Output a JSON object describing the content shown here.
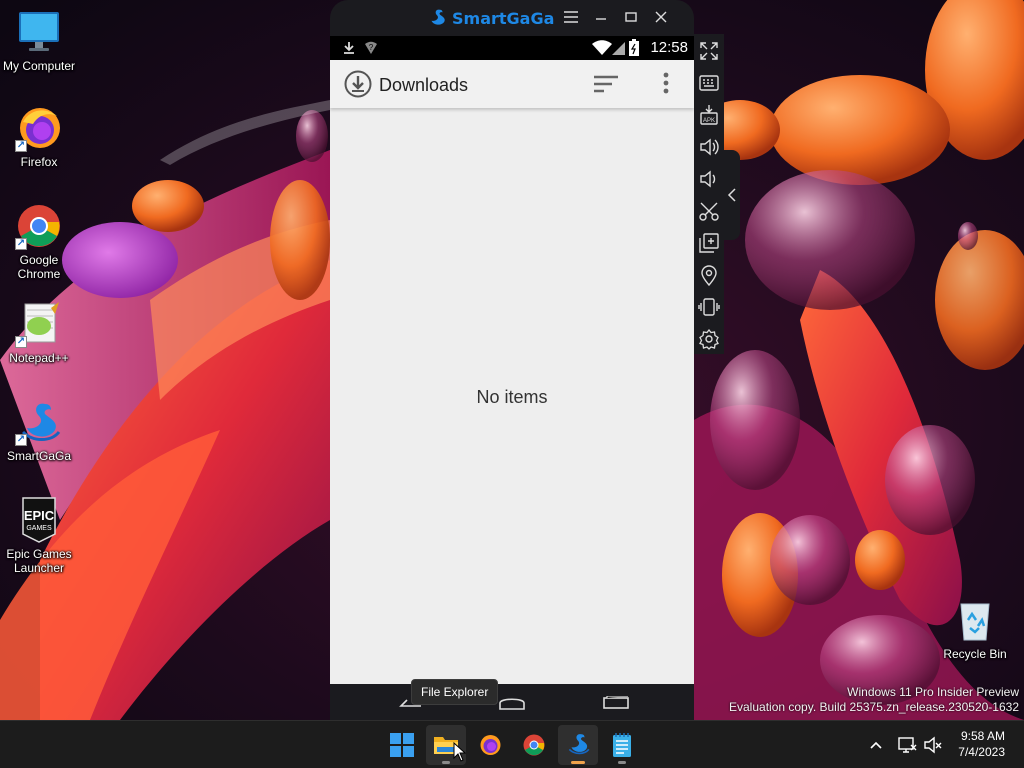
{
  "desktop": {
    "icons": [
      {
        "label": "My Computer"
      },
      {
        "label": "Firefox"
      },
      {
        "label": "Google Chrome"
      },
      {
        "label": "Notepad++"
      },
      {
        "label": "SmartGaGa"
      },
      {
        "label": "Epic Games Launcher"
      },
      {
        "label": "Recycle Bin"
      }
    ]
  },
  "emulator": {
    "window_title": "SmartGaGa",
    "status_time": "12:58",
    "app_title": "Downloads",
    "empty_message": "No items",
    "colors": {
      "brand": "#1e88e5",
      "frame": "#1b1b1f",
      "content_bg": "#eeeeee"
    }
  },
  "tooltip": "File Explorer",
  "watermark": {
    "line1": "Windows 11 Pro Insider Preview",
    "line2": "Evaluation copy. Build 25375.zn_release.230520-1632"
  },
  "taskbar": {
    "apps": [
      "start-icon",
      "file-explorer-icon",
      "firefox-icon",
      "chrome-icon",
      "smartgaga-icon",
      "notepad-icon"
    ],
    "clock_time": "9:58 AM",
    "clock_date": "7/4/2023"
  }
}
